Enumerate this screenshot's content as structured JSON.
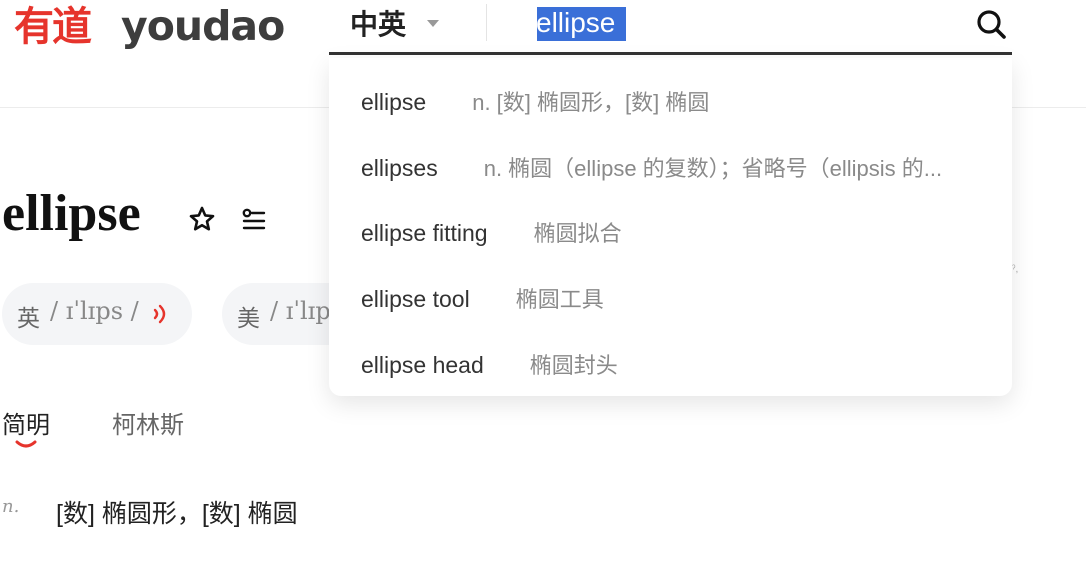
{
  "header": {
    "logo_chinese": "有道",
    "logo_text": "youdao",
    "lang_select": "中英",
    "search_value": "ellipse"
  },
  "suggestions": [
    {
      "word": "ellipse",
      "meaning": "n. [数] 椭圆形，[数] 椭圆"
    },
    {
      "word": "ellipses",
      "meaning": "n. 椭圆（ellipse 的复数）；省略号（ellipsis 的..."
    },
    {
      "word": "ellipse fitting",
      "meaning": "椭圆拟合"
    },
    {
      "word": "ellipse tool",
      "meaning": "椭圆工具"
    },
    {
      "word": "ellipse head",
      "meaning": "椭圆封头"
    }
  ],
  "entry": {
    "word": "ellipse",
    "phonetics": [
      {
        "label": "英",
        "ipa": "/ ɪˈlɪps /"
      },
      {
        "label": "美",
        "ipa": "/ ɪˈlɪps /"
      }
    ],
    "tabs": [
      "简明",
      "柯林斯"
    ],
    "active_tab": "简明",
    "definitions": [
      {
        "pos": "n.",
        "text": "[数] 椭圆形，[数] 椭圆"
      }
    ]
  },
  "colors": {
    "brand_red": "#e6342c",
    "selection_blue": "#3a6fd8",
    "text_dark": "#222222",
    "text_gray": "#8a8a8a"
  },
  "icons": [
    "search-icon",
    "star-icon",
    "wordlist-icon",
    "speaker-icon",
    "chevron-down-icon"
  ]
}
